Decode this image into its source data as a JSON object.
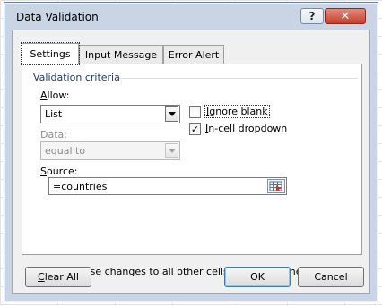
{
  "window": {
    "title": "Data Validation",
    "help_label": "?",
    "close_label": "✕"
  },
  "tabs": [
    {
      "label": "Settings",
      "active": true
    },
    {
      "label": "Input Message",
      "active": false
    },
    {
      "label": "Error Alert",
      "active": false
    }
  ],
  "settings": {
    "criteria_title": "Validation criteria",
    "allow_label_accel": "A",
    "allow_label_rest": "llow:",
    "allow_value": "List",
    "data_label": "Data:",
    "data_value": "equal to",
    "ignore_blank": {
      "accel": "I",
      "rest": "gnore blank",
      "checked": false
    },
    "in_cell_dropdown": {
      "accel": "I",
      "rest": "n-cell dropdown",
      "checked": true
    },
    "source_label_accel": "S",
    "source_label_rest": "ource:",
    "source_value": "=countries",
    "apply_all": {
      "pre": "Ap",
      "accel": "p",
      "rest": "ly these changes to all other cells with the same settings",
      "checked": false
    }
  },
  "buttons": {
    "clear_all_accel": "C",
    "clear_all_rest": "lear All",
    "ok": "OK",
    "cancel": "Cancel"
  },
  "icons": {
    "checkmark": "✓",
    "range_selector": "range-select-icon"
  }
}
